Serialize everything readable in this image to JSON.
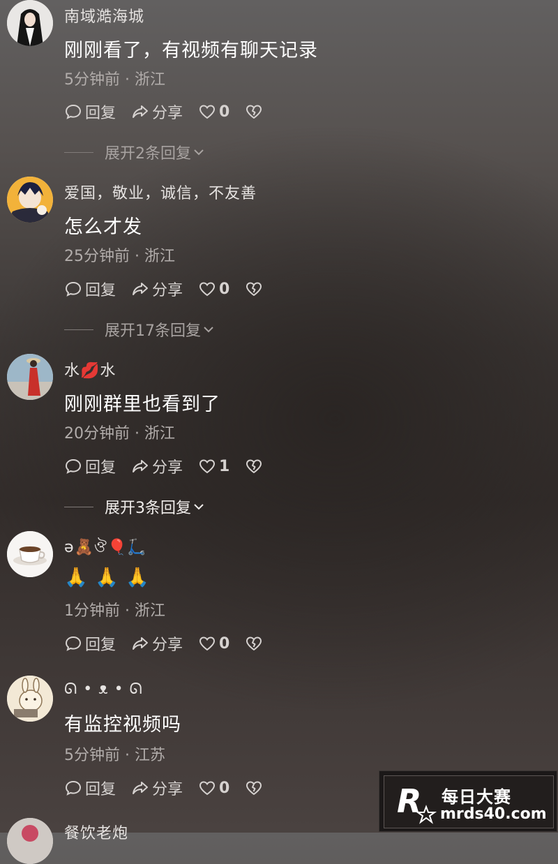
{
  "actions": {
    "reply": "回复",
    "share": "分享"
  },
  "comments": [
    {
      "username": "南域澔海城",
      "text": "刚刚看了，有视频有聊天记录",
      "meta": "5分钟前 · 浙江",
      "likes": "0",
      "expand": "展开2条回复"
    },
    {
      "username": "爱国，敬业，诚信，不友善",
      "text": "怎么才发",
      "meta": "25分钟前 · 浙江",
      "likes": "0",
      "expand": "展开17条回复"
    },
    {
      "username": "水💋水",
      "text": "刚刚群里也看到了",
      "meta": "20分钟前 · 浙江",
      "likes": "1",
      "expand": "展开3条回复"
    },
    {
      "username": "ə🧸ঔ🎈🛴",
      "text": "🙏 🙏 🙏",
      "meta": "1分钟前 · 浙江",
      "likes": "0"
    },
    {
      "username": "ᘏ • ᴥ • ᘏ",
      "text": "有监控视频吗",
      "meta": "5分钟前 · 江苏",
      "likes": "0"
    },
    {
      "username": "餐饮老炮"
    }
  ],
  "watermark": {
    "title": "每日大赛",
    "url": "mrds40.com"
  }
}
